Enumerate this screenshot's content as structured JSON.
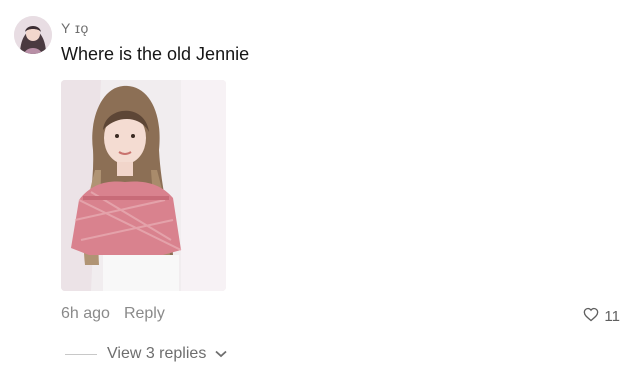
{
  "comment": {
    "username": "Y ɪǫ",
    "text": "Where is the old Jennie",
    "timestamp": "6h ago",
    "reply_label": "Reply",
    "like_count": "11",
    "view_replies_label": "View 3 replies",
    "icons": {
      "like": "heart-outline-icon",
      "expand": "chevron-down-icon"
    },
    "colors": {
      "text_primary": "#161616",
      "text_secondary": "#8a8a8a",
      "background": "#ffffff"
    }
  }
}
